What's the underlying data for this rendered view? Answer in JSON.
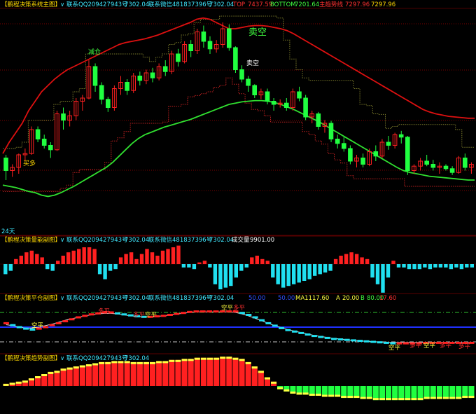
{
  "panes": {
    "main": {
      "title": "【鹏程决策系统主图】",
      "contact_qq": "联系QQ209427943号",
      "contact_qq_value": "7302.04",
      "contact_wx": "联系微信481837396号",
      "contact_wx_value": "7302.04",
      "top_label": "TOP",
      "top_value": "7437.59",
      "bottom_label": "BOTTOM",
      "bottom_value": "7201.64",
      "trend_label": "主趋势线",
      "trend_value1": "7297.96",
      "trend_value2": "7297.96",
      "period_label": "24天",
      "signals": {
        "buy_label": "买多",
        "reduce_label": "减仓",
        "sell_label": "卖空",
        "short_label": "卖空"
      }
    },
    "volume": {
      "title": "【鹏程决策量能副图】",
      "contact_qq": "联系QQ209427943号",
      "contact_qq_value": "7302.04",
      "contact_wx": "联系微信481837396号",
      "contact_wx_value": "7302.04",
      "vol_label": "成交量",
      "vol_value": "9901.00"
    },
    "position": {
      "title": "【鹏程决策平仓副图】",
      "contact_qq": "联系QQ209427943号",
      "contact_qq_value": "7302.04",
      "contact_wx": "联系微信481837396号",
      "contact_wx_value": "7302.04",
      "param1": "50.00",
      "param2": "50.00",
      "ma_label": "MA11",
      "ma_value": "17.60",
      "a_label": "A",
      "a_value": "20.00",
      "b_label": "B",
      "b_value": "80.00",
      "last_value": "17.60",
      "signals": {
        "short_close": "空平",
        "long_close": "多平"
      }
    },
    "trend": {
      "title": "【鹏程决策趋势副图】",
      "contact_qq": "联系QQ209427943号",
      "contact_qq_value": "7302.04"
    }
  },
  "colors": {
    "background": "#000000",
    "up": "#ff2020",
    "down": "#20ff40",
    "upper_band": "#dd1010",
    "lower_band": "#30e030",
    "cyan": "#20e0f0",
    "yellow": "#ffff40",
    "grid": "#8a0000",
    "title_yellow": "#ffd800",
    "title_cyan": "#40e8ff",
    "title_red": "#ff3030",
    "title_green": "#40ff40"
  },
  "chart_data": [
    {
      "type": "candlestick",
      "xlabel": "",
      "ylabel": "",
      "price_range": [
        7160,
        7460
      ],
      "candles": [
        [
          7225,
          7230,
          7190,
          7205
        ],
        [
          7205,
          7215,
          7195,
          7210
        ],
        [
          7210,
          7232,
          7200,
          7230
        ],
        [
          7230,
          7240,
          7220,
          7232
        ],
        [
          7232,
          7275,
          7230,
          7270
        ],
        [
          7270,
          7275,
          7250,
          7255
        ],
        [
          7255,
          7262,
          7240,
          7245
        ],
        [
          7245,
          7250,
          7225,
          7238
        ],
        [
          7238,
          7300,
          7236,
          7295
        ],
        [
          7295,
          7305,
          7270,
          7285
        ],
        [
          7285,
          7300,
          7275,
          7292
        ],
        [
          7292,
          7320,
          7285,
          7315
        ],
        [
          7315,
          7325,
          7300,
          7320
        ],
        [
          7320,
          7380,
          7318,
          7370
        ],
        [
          7370,
          7375,
          7330,
          7340
        ],
        [
          7340,
          7345,
          7310,
          7318
        ],
        [
          7318,
          7322,
          7298,
          7305
        ],
        [
          7305,
          7340,
          7300,
          7335
        ],
        [
          7335,
          7355,
          7325,
          7345
        ],
        [
          7345,
          7350,
          7325,
          7332
        ],
        [
          7332,
          7360,
          7328,
          7355
        ],
        [
          7355,
          7362,
          7340,
          7348
        ],
        [
          7348,
          7365,
          7342,
          7360
        ],
        [
          7360,
          7368,
          7345,
          7352
        ],
        [
          7352,
          7375,
          7348,
          7370
        ],
        [
          7370,
          7380,
          7355,
          7362
        ],
        [
          7362,
          7395,
          7358,
          7390
        ],
        [
          7390,
          7398,
          7370,
          7378
        ],
        [
          7378,
          7410,
          7375,
          7405
        ],
        [
          7405,
          7412,
          7385,
          7395
        ],
        [
          7395,
          7430,
          7390,
          7425
        ],
        [
          7425,
          7435,
          7400,
          7410
        ],
        [
          7410,
          7418,
          7390,
          7398
        ],
        [
          7398,
          7412,
          7392,
          7405
        ],
        [
          7405,
          7440,
          7400,
          7430
        ],
        [
          7430,
          7437,
          7395,
          7400
        ],
        [
          7400,
          7402,
          7360,
          7365
        ],
        [
          7365,
          7372,
          7345,
          7350
        ],
        [
          7350,
          7355,
          7330,
          7340
        ],
        [
          7340,
          7342,
          7320,
          7325
        ],
        [
          7325,
          7335,
          7318,
          7330
        ],
        [
          7330,
          7335,
          7310,
          7315
        ],
        [
          7315,
          7320,
          7300,
          7310
        ],
        [
          7310,
          7318,
          7305,
          7312
        ],
        [
          7312,
          7320,
          7300,
          7305
        ],
        [
          7305,
          7335,
          7300,
          7330
        ],
        [
          7330,
          7338,
          7315,
          7320
        ],
        [
          7320,
          7325,
          7285,
          7290
        ],
        [
          7290,
          7300,
          7280,
          7295
        ],
        [
          7295,
          7298,
          7270,
          7275
        ],
        [
          7275,
          7285,
          7265,
          7280
        ],
        [
          7280,
          7284,
          7250,
          7255
        ],
        [
          7255,
          7262,
          7240,
          7248
        ],
        [
          7248,
          7258,
          7235,
          7240
        ],
        [
          7240,
          7245,
          7215,
          7220
        ],
        [
          7220,
          7230,
          7210,
          7225
        ],
        [
          7225,
          7232,
          7210,
          7215
        ],
        [
          7215,
          7240,
          7212,
          7235
        ],
        [
          7235,
          7245,
          7220,
          7228
        ],
        [
          7228,
          7255,
          7225,
          7250
        ],
        [
          7250,
          7260,
          7238,
          7245
        ],
        [
          7245,
          7265,
          7240,
          7262
        ],
        [
          7262,
          7268,
          7248,
          7258
        ],
        [
          7258,
          7260,
          7198,
          7205
        ],
        [
          7205,
          7215,
          7200,
          7212
        ],
        [
          7212,
          7225,
          7205,
          7220
        ],
        [
          7220,
          7230,
          7212,
          7215
        ],
        [
          7215,
          7222,
          7205,
          7210
        ],
        [
          7210,
          7218,
          7200,
          7212
        ],
        [
          7212,
          7215,
          7205,
          7208
        ],
        [
          7208,
          7212,
          7198,
          7202
        ],
        [
          7202,
          7228,
          7200,
          7225
        ],
        [
          7225,
          7232,
          7205,
          7210
        ],
        [
          7210,
          7218,
          7200,
          7215
        ]
      ],
      "upper_band": [
        7232,
        7250,
        7265,
        7280,
        7300,
        7315,
        7330,
        7340,
        7350,
        7358,
        7365,
        7370,
        7375,
        7380,
        7385,
        7390,
        7395,
        7400,
        7405,
        7408,
        7410,
        7412,
        7414,
        7417,
        7420,
        7424,
        7428,
        7432,
        7436,
        7440,
        7445,
        7447,
        7445,
        7440,
        7435,
        7430,
        7430,
        7432,
        7434,
        7435,
        7435,
        7434,
        7432,
        7430,
        7427,
        7422,
        7416,
        7410,
        7404,
        7398,
        7392,
        7386,
        7380,
        7374,
        7368,
        7362,
        7356,
        7350,
        7344,
        7338,
        7332,
        7326,
        7320,
        7314,
        7308,
        7302,
        7298,
        7295,
        7293,
        7291,
        7290,
        7289,
        7288,
        7288
      ],
      "lower_band": [
        7182,
        7180,
        7178,
        7175,
        7172,
        7170,
        7166,
        7164,
        7166,
        7170,
        7175,
        7180,
        7186,
        7192,
        7198,
        7204,
        7210,
        7218,
        7228,
        7238,
        7248,
        7256,
        7262,
        7266,
        7270,
        7274,
        7277,
        7280,
        7283,
        7286,
        7290,
        7294,
        7298,
        7302,
        7306,
        7310,
        7312,
        7314,
        7315,
        7316,
        7316,
        7315,
        7313,
        7310,
        7306,
        7302,
        7297,
        7292,
        7287,
        7282,
        7276,
        7270,
        7264,
        7258,
        7252,
        7246,
        7240,
        7234,
        7228,
        7222,
        7216,
        7210,
        7205,
        7202,
        7200,
        7198,
        7196,
        7195,
        7194,
        7193,
        7192,
        7191,
        7190,
        7190
      ],
      "bottom_level": 7201.64,
      "top_level": 7437.59
    },
    {
      "type": "bar",
      "xlabel": "",
      "ylabel": "",
      "values": [
        -6,
        -4,
        3,
        5,
        7,
        8,
        6,
        4,
        -3,
        -4,
        2,
        5,
        7,
        8,
        9,
        10,
        10,
        9,
        -6,
        -9,
        -4,
        -3,
        4,
        6,
        7,
        3,
        6,
        9,
        7,
        5,
        8,
        9,
        10,
        11,
        -2,
        -2,
        -3,
        1,
        2,
        -2,
        -12,
        -15,
        -14,
        -13,
        -8,
        -4,
        -2,
        4,
        5,
        3,
        2,
        -8,
        -12,
        -14,
        -13,
        -12,
        -11,
        -10,
        -9,
        -7,
        -6,
        -5,
        -4,
        3,
        5,
        6,
        7,
        6,
        4,
        3,
        -8,
        -12,
        -17,
        -8,
        2,
        -2,
        -2,
        -3,
        -3,
        -3,
        -2,
        -3,
        -2,
        -2,
        -2,
        -3,
        -2,
        -3,
        -2,
        -2
      ]
    },
    {
      "type": "line",
      "xlabel": "",
      "ylabel": "",
      "ylim": [
        0,
        100
      ],
      "cyan_series": [
        58,
        54,
        50,
        47,
        45,
        47,
        50,
        54,
        58,
        62,
        66,
        70,
        73,
        76,
        78,
        80,
        80,
        78,
        76,
        74,
        72,
        71,
        71,
        72,
        73,
        75,
        77,
        79,
        81,
        82,
        82,
        82,
        82,
        82,
        82,
        82,
        79,
        75,
        70,
        64,
        58,
        53,
        48,
        44,
        41,
        38,
        35,
        32,
        30,
        28,
        26,
        25,
        24,
        23,
        22,
        21,
        20,
        19,
        18,
        17,
        17,
        17,
        17,
        17,
        18,
        18,
        18,
        18,
        18,
        18,
        18,
        18
      ],
      "signal_series": [
        55,
        53,
        50,
        48,
        48,
        50,
        53,
        56,
        60,
        64,
        67,
        70,
        73,
        75,
        77,
        78,
        78,
        77,
        75,
        73,
        72,
        71,
        71,
        72,
        73,
        75,
        77,
        78,
        80,
        81,
        81,
        81,
        81,
        81,
        81,
        80,
        77,
        73,
        68,
        63,
        58,
        53,
        49,
        45,
        42,
        39,
        36,
        33,
        31,
        29,
        27,
        26,
        24,
        23,
        22,
        21,
        20,
        20,
        19,
        19,
        19,
        19,
        19,
        19,
        19,
        19,
        19,
        18,
        18,
        18,
        18,
        18
      ],
      "levels": {
        "A": 20,
        "B": 80,
        "mid": 50
      }
    },
    {
      "type": "bar",
      "xlabel": "",
      "ylabel": "",
      "values": [
        2,
        3,
        4,
        5,
        7,
        9,
        11,
        13,
        14,
        16,
        17,
        18,
        19,
        20,
        21,
        22,
        22,
        23,
        23,
        23,
        22,
        22,
        22,
        22,
        23,
        23,
        24,
        24,
        25,
        25,
        26,
        26,
        26,
        26,
        27,
        27,
        26,
        25,
        22,
        18,
        14,
        8,
        4,
        -3,
        -5,
        -7,
        -8,
        -8,
        -9,
        -9,
        -10,
        -10,
        -10,
        -11,
        -11,
        -11,
        -12,
        -12,
        -13,
        -13,
        -13,
        -13,
        -13,
        -13,
        -13,
        -13,
        -12,
        -12,
        -12,
        -12,
        -12,
        -12,
        -11,
        -11
      ]
    }
  ]
}
